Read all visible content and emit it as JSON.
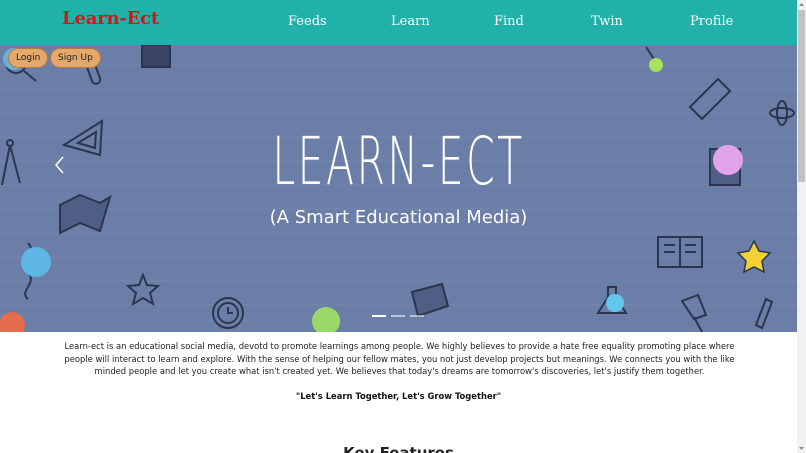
{
  "navbar": {
    "brand": "Learn-Ect",
    "links": [
      "Feeds",
      "Learn",
      "Find",
      "Twin",
      "Profile"
    ]
  },
  "hero": {
    "login_label": "Login",
    "signup_label": "Sign Up",
    "title": "LEARN-ECT",
    "subtitle": "(A Smart Educational Media)",
    "slide_count": 3,
    "active_slide": 1
  },
  "about": {
    "text": "Learn-ect is an educational social media, devotd to promote learnings among people. We highly believes to provide a hate free equality promoting place where people will interact to learn and explore. With the sense of helping our fellow mates, you not just develop projects but meanings. We connects you with the like minded people and let you create what isn't created yet. We believes that today's dreams are tomorrow's discoveries, let's justify them together.",
    "motto": "\"Let's Learn Together, Let's Grow Together\""
  },
  "features": {
    "heading": "Key Features"
  },
  "colors": {
    "navbar": "#20b2aa",
    "brand": "#d61515",
    "hero_bg": "#6a7ea7",
    "auth_button": "#e4a86a"
  }
}
